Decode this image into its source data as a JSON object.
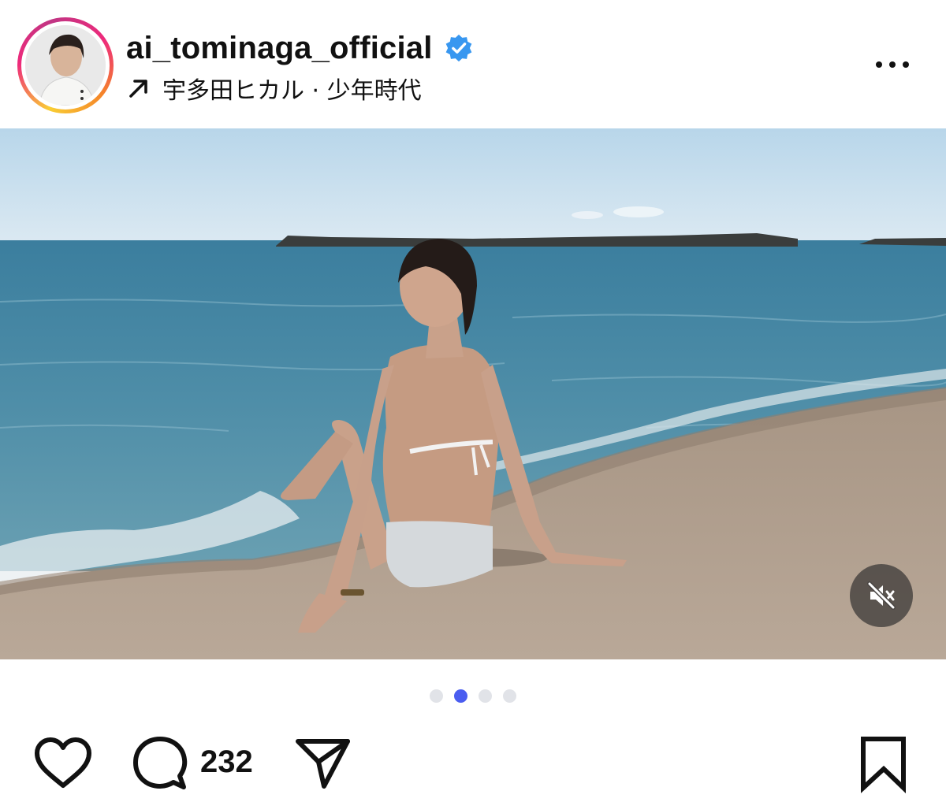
{
  "post": {
    "username": "ai_tominaga_official",
    "verified": true,
    "audio_label": "宇多田ヒカル · 少年時代",
    "comment_count": "232"
  },
  "icons": {
    "more": "more-options-icon",
    "verified": "verified-badge-icon",
    "audio": "arrow-up-right-icon",
    "mute": "speaker-muted-icon",
    "like": "heart-icon",
    "comment": "comment-bubble-icon",
    "share": "paper-plane-icon",
    "save": "bookmark-icon"
  },
  "carousel": {
    "total": 4,
    "active_index": 1
  },
  "colors": {
    "verified": "#3897f0",
    "active_dot": "#4a5df0",
    "inactive_dot": "#e1e3e8"
  }
}
